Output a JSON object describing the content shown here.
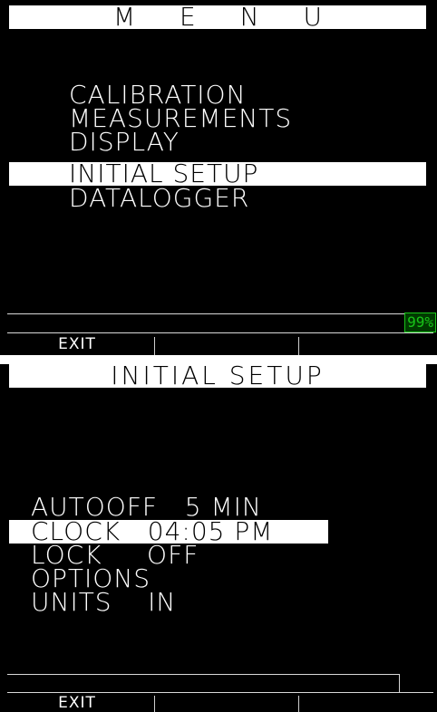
{
  "screen1": {
    "title": "M E N U",
    "items": [
      {
        "label": "CALIBRATION",
        "selected": false
      },
      {
        "label": "MEASUREMENTS",
        "selected": false
      },
      {
        "label": "DISPLAY",
        "selected": false
      },
      {
        "label": "INITIAL SETUP",
        "selected": true
      },
      {
        "label": "DATALOGGER",
        "selected": false
      }
    ],
    "battery": "99%",
    "softkeys": [
      "EXIT",
      "",
      ""
    ]
  },
  "screen2": {
    "title": "INITIAL SETUP",
    "items": [
      {
        "label": "AUTOOFF   5 MIN",
        "selected": false
      },
      {
        "label": "CLOCK   04:05 PM",
        "selected": true
      },
      {
        "label": "LOCK     OFF",
        "selected": false
      },
      {
        "label": "OPTIONS",
        "selected": false
      },
      {
        "label": "UNITS    IN",
        "selected": false
      }
    ],
    "softkeys": [
      "EXIT",
      "",
      ""
    ]
  },
  "colors": {
    "screen_bg": "#000000",
    "text": "#ffffff",
    "highlight_bg": "#ffffff",
    "battery_green": "#19c419"
  }
}
